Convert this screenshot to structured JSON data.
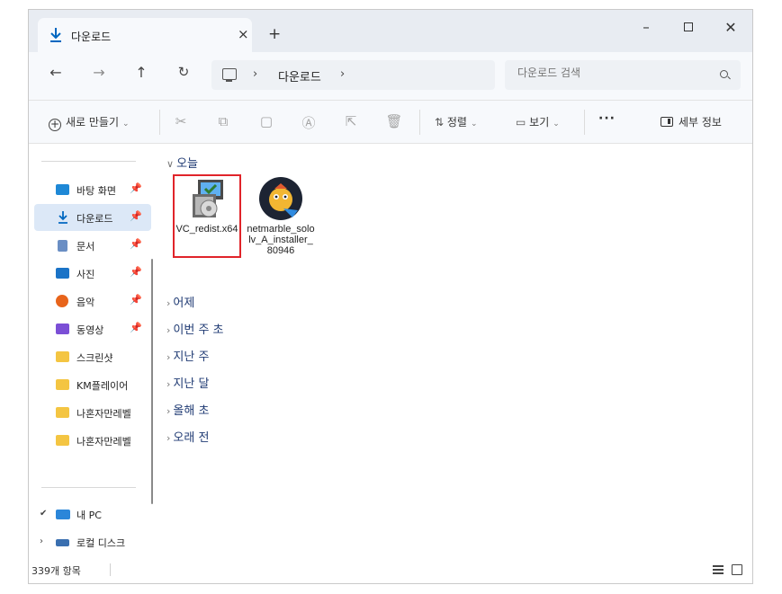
{
  "window": {
    "tab_title": "다운로드",
    "tab_close": "×",
    "new_tab": "+",
    "minimize": "–",
    "close": "✕"
  },
  "addressbar": {
    "back": "←",
    "forward": "→",
    "up": "↑",
    "refresh": "↻",
    "crumb_separator": "›",
    "breadcrumb": [
      "다운로드"
    ],
    "search_placeholder": "다운로드 검색"
  },
  "toolbar": {
    "new_label": "새로 만들기",
    "sort_label": "정렬",
    "view_label": "보기",
    "more_label": "···",
    "details_label": "세부 정보",
    "dropdown_caret": "⌄"
  },
  "sidebar": {
    "pinned": [
      {
        "label": "바탕 화면",
        "icon": "desktop-icon",
        "pinned": true
      },
      {
        "label": "다운로드",
        "icon": "download-icon",
        "pinned": true,
        "selected": true
      },
      {
        "label": "문서",
        "icon": "document-icon",
        "pinned": true
      },
      {
        "label": "사진",
        "icon": "pictures-icon",
        "pinned": true
      },
      {
        "label": "음악",
        "icon": "music-icon",
        "pinned": true
      },
      {
        "label": "동영상",
        "icon": "video-icon",
        "pinned": true
      },
      {
        "label": "스크린샷",
        "icon": "folder-icon"
      },
      {
        "label": "KM플레이어",
        "icon": "folder-icon"
      },
      {
        "label": "나혼자만레벨",
        "icon": "folder-icon"
      },
      {
        "label": "나혼자만레벨",
        "icon": "folder-icon"
      }
    ],
    "pin_glyph": "📌",
    "this_pc_label": "내 PC",
    "local_disk_label": "로컬 디스크"
  },
  "content": {
    "groups": [
      {
        "label": "오늘",
        "expanded": true
      },
      {
        "label": "어제"
      },
      {
        "label": "이번 주 초"
      },
      {
        "label": "지난 주"
      },
      {
        "label": "지난 달"
      },
      {
        "label": "올해 초"
      },
      {
        "label": "오래 전"
      }
    ],
    "files": [
      {
        "name": "VC_redist.x64",
        "icon": "installer-icon",
        "highlighted": true
      },
      {
        "name": "netmarble_sololv_A_installer_80946",
        "icon": "netmarble-icon"
      }
    ]
  },
  "statusbar": {
    "item_count": "339개 항목"
  },
  "colors": {
    "accent": "#0067c0",
    "highlight_border": "#e0242a",
    "selected_bg": "#dce8f7",
    "folder": "#f4c542"
  }
}
